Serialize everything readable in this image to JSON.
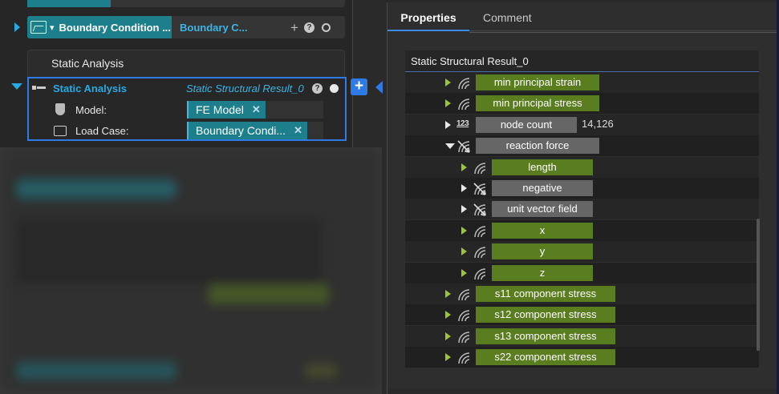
{
  "left": {
    "bc_node": {
      "label": "Boundary Condition ...",
      "sub_label": "Boundary C...",
      "chevron": "▾"
    },
    "static_section": {
      "header": "Static Analysis"
    },
    "sa_node": {
      "title": "Static Analysis",
      "subtitle": "Static Structural Result_0",
      "help": "?",
      "fields": [
        {
          "label": "Model:",
          "value": "FE Model",
          "remove": "✕"
        },
        {
          "label": "Load Case:",
          "value": "Boundary Condi...",
          "remove": "✕"
        }
      ]
    },
    "add_button": "+"
  },
  "panel": {
    "tabs": [
      {
        "label": "Properties",
        "active": true
      },
      {
        "label": "Comment",
        "active": false
      }
    ],
    "result_title": "Static Structural Result_0",
    "tree": [
      {
        "label": "min principal strain",
        "color": "green",
        "expand": "right",
        "indent": 0,
        "icon": "field-icon"
      },
      {
        "label": "min principal stress",
        "color": "green",
        "expand": "right",
        "indent": 0,
        "icon": "field-icon"
      },
      {
        "label": "node count",
        "color": "gray",
        "expand": "right-white",
        "indent": 0,
        "icon": "number-icon",
        "value": "14,126",
        "icon_text": "123"
      },
      {
        "label": "reaction force",
        "color": "gray",
        "expand": "down",
        "indent": 0,
        "icon": "vector-icon"
      },
      {
        "label": "length",
        "color": "green",
        "expand": "right",
        "indent": 1,
        "icon": "field-icon"
      },
      {
        "label": "negative",
        "color": "gray",
        "expand": "right-white",
        "indent": 1,
        "icon": "vector-icon"
      },
      {
        "label": "unit vector field",
        "color": "gray",
        "expand": "right-white",
        "indent": 1,
        "icon": "vector-icon"
      },
      {
        "label": "x",
        "color": "green",
        "expand": "right",
        "indent": 1,
        "icon": "field-icon"
      },
      {
        "label": "y",
        "color": "green",
        "expand": "right",
        "indent": 1,
        "icon": "field-icon"
      },
      {
        "label": "z",
        "color": "green",
        "expand": "right",
        "indent": 1,
        "icon": "field-icon"
      },
      {
        "label": "s11 component stress",
        "color": "green",
        "expand": "right",
        "indent": 0,
        "icon": "field-icon"
      },
      {
        "label": "s12 component stress",
        "color": "green",
        "expand": "right",
        "indent": 0,
        "icon": "field-icon"
      },
      {
        "label": "s13 component stress",
        "color": "green",
        "expand": "right",
        "indent": 0,
        "icon": "field-icon"
      },
      {
        "label": "s22 component stress",
        "color": "green",
        "expand": "right",
        "indent": 0,
        "icon": "field-icon"
      }
    ]
  },
  "colors": {
    "accent_blue": "#2f7be6",
    "teal": "#1e7f8c",
    "field_green": "#5a7d1f",
    "field_gray": "#666666",
    "arrow_green": "#9bc53d"
  }
}
